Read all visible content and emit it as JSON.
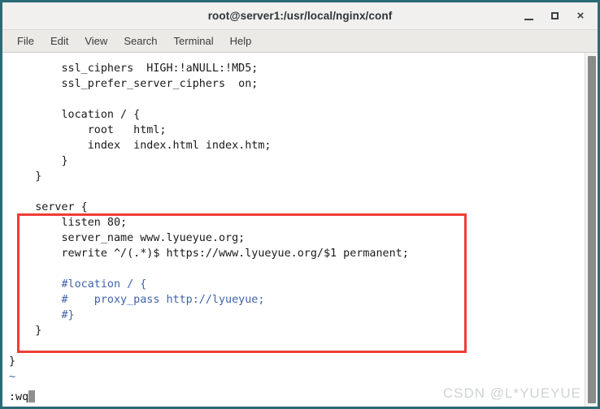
{
  "window": {
    "title": "root@server1:/usr/local/nginx/conf",
    "border_color": "#2b6a74",
    "controls": {
      "minimize": "minimize-icon",
      "maximize": "maximize-icon",
      "close": "×"
    }
  },
  "menubar": {
    "items": [
      {
        "label": "File"
      },
      {
        "label": "Edit"
      },
      {
        "label": "View"
      },
      {
        "label": "Search"
      },
      {
        "label": "Terminal"
      },
      {
        "label": "Help"
      }
    ]
  },
  "editor": {
    "colors": {
      "text": "#1a1a1a",
      "comment": "#3f63ac",
      "annotation_box": "#f03c35"
    },
    "lines": [
      {
        "text": "        ssl_ciphers  HIGH:!aNULL:!MD5;",
        "style": "code"
      },
      {
        "text": "        ssl_prefer_server_ciphers  on;",
        "style": "code"
      },
      {
        "text": "",
        "style": "code"
      },
      {
        "text": "        location / {",
        "style": "code"
      },
      {
        "text": "            root   html;",
        "style": "code"
      },
      {
        "text": "            index  index.html index.htm;",
        "style": "code"
      },
      {
        "text": "        }",
        "style": "code"
      },
      {
        "text": "    }",
        "style": "code"
      },
      {
        "text": "",
        "style": "code"
      },
      {
        "text": "    server {",
        "style": "code"
      },
      {
        "text": "        listen 80;",
        "style": "code"
      },
      {
        "text": "        server_name www.lyueyue.org;",
        "style": "code"
      },
      {
        "text": "        rewrite ^/(.*)$ https://www.lyueyue.org/$1 permanent;",
        "style": "code"
      },
      {
        "text": "",
        "style": "code"
      },
      {
        "text": "        #location / {",
        "style": "comment"
      },
      {
        "text": "        #    proxy_pass http://lyueyue;",
        "style": "comment"
      },
      {
        "text": "        #}",
        "style": "comment"
      },
      {
        "text": "    }",
        "style": "code"
      },
      {
        "text": "",
        "style": "code"
      },
      {
        "text": "}",
        "style": "code"
      },
      {
        "text": "~",
        "style": "tilde"
      }
    ],
    "command_line": ":wq"
  },
  "watermark": {
    "text": "CSDN @L*YUEYUE"
  }
}
